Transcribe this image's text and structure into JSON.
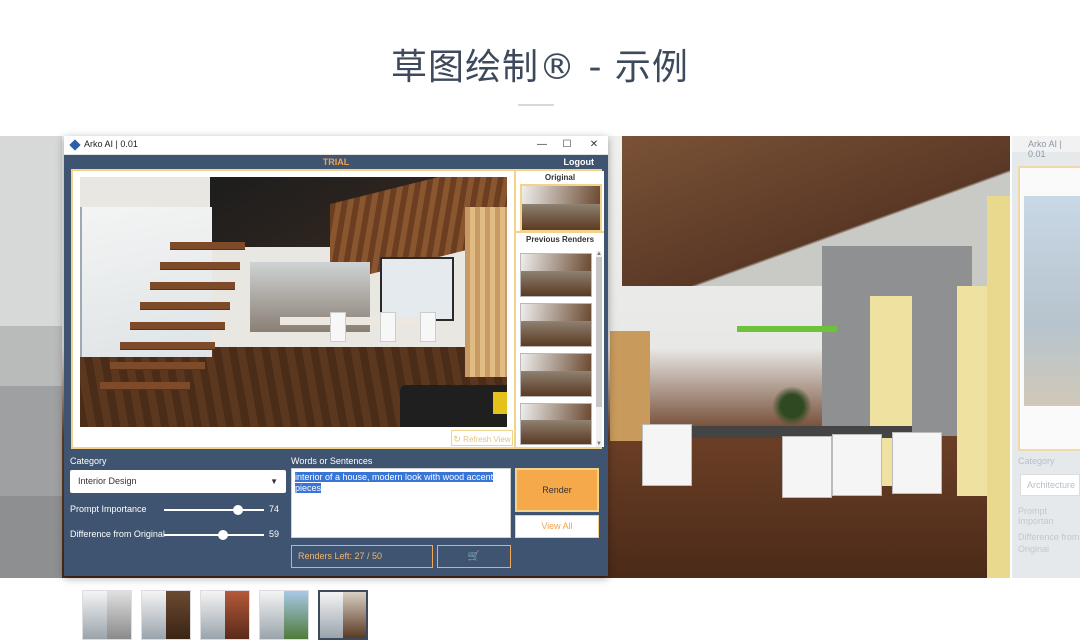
{
  "page": {
    "title": "草图绘制® - 示例"
  },
  "app": {
    "window_title": "Arko AI | 0.01",
    "controls": {
      "minimize": "—",
      "maximize": "☐",
      "close": "✕"
    },
    "trial_label": "TRIAL",
    "logout_label": "Logout",
    "refresh_view_label": "Refresh View",
    "original_label": "Original",
    "previous_renders_label": "Previous Renders",
    "category": {
      "label": "Category",
      "value": "Interior Design"
    },
    "prompt_importance": {
      "label": "Prompt Importance",
      "value": "74",
      "fraction": 0.74
    },
    "difference_from_original": {
      "label": "Difference from Original",
      "value": "59",
      "fraction": 0.59
    },
    "words": {
      "label": "Words or Sentences",
      "value": "interior of a house, modern look with wood accent pieces"
    },
    "render_button": "Render",
    "view_all_button": "View All",
    "renders_left": "Renders Left: 27 / 50",
    "cart_icon": "cart-icon"
  },
  "next_slide": {
    "window_title": "Arko AI | 0.01",
    "category_label": "Category",
    "category_value": "Architecture",
    "prompt_label": "Prompt Importan",
    "difference_label": "Difference from Original"
  },
  "colors": {
    "accent": "#f6a94a",
    "panel": "#3f5470",
    "frame": "#f3d28c",
    "title": "#3d4a5c"
  },
  "thumbnails": {
    "count": 5,
    "active_index": 4
  }
}
